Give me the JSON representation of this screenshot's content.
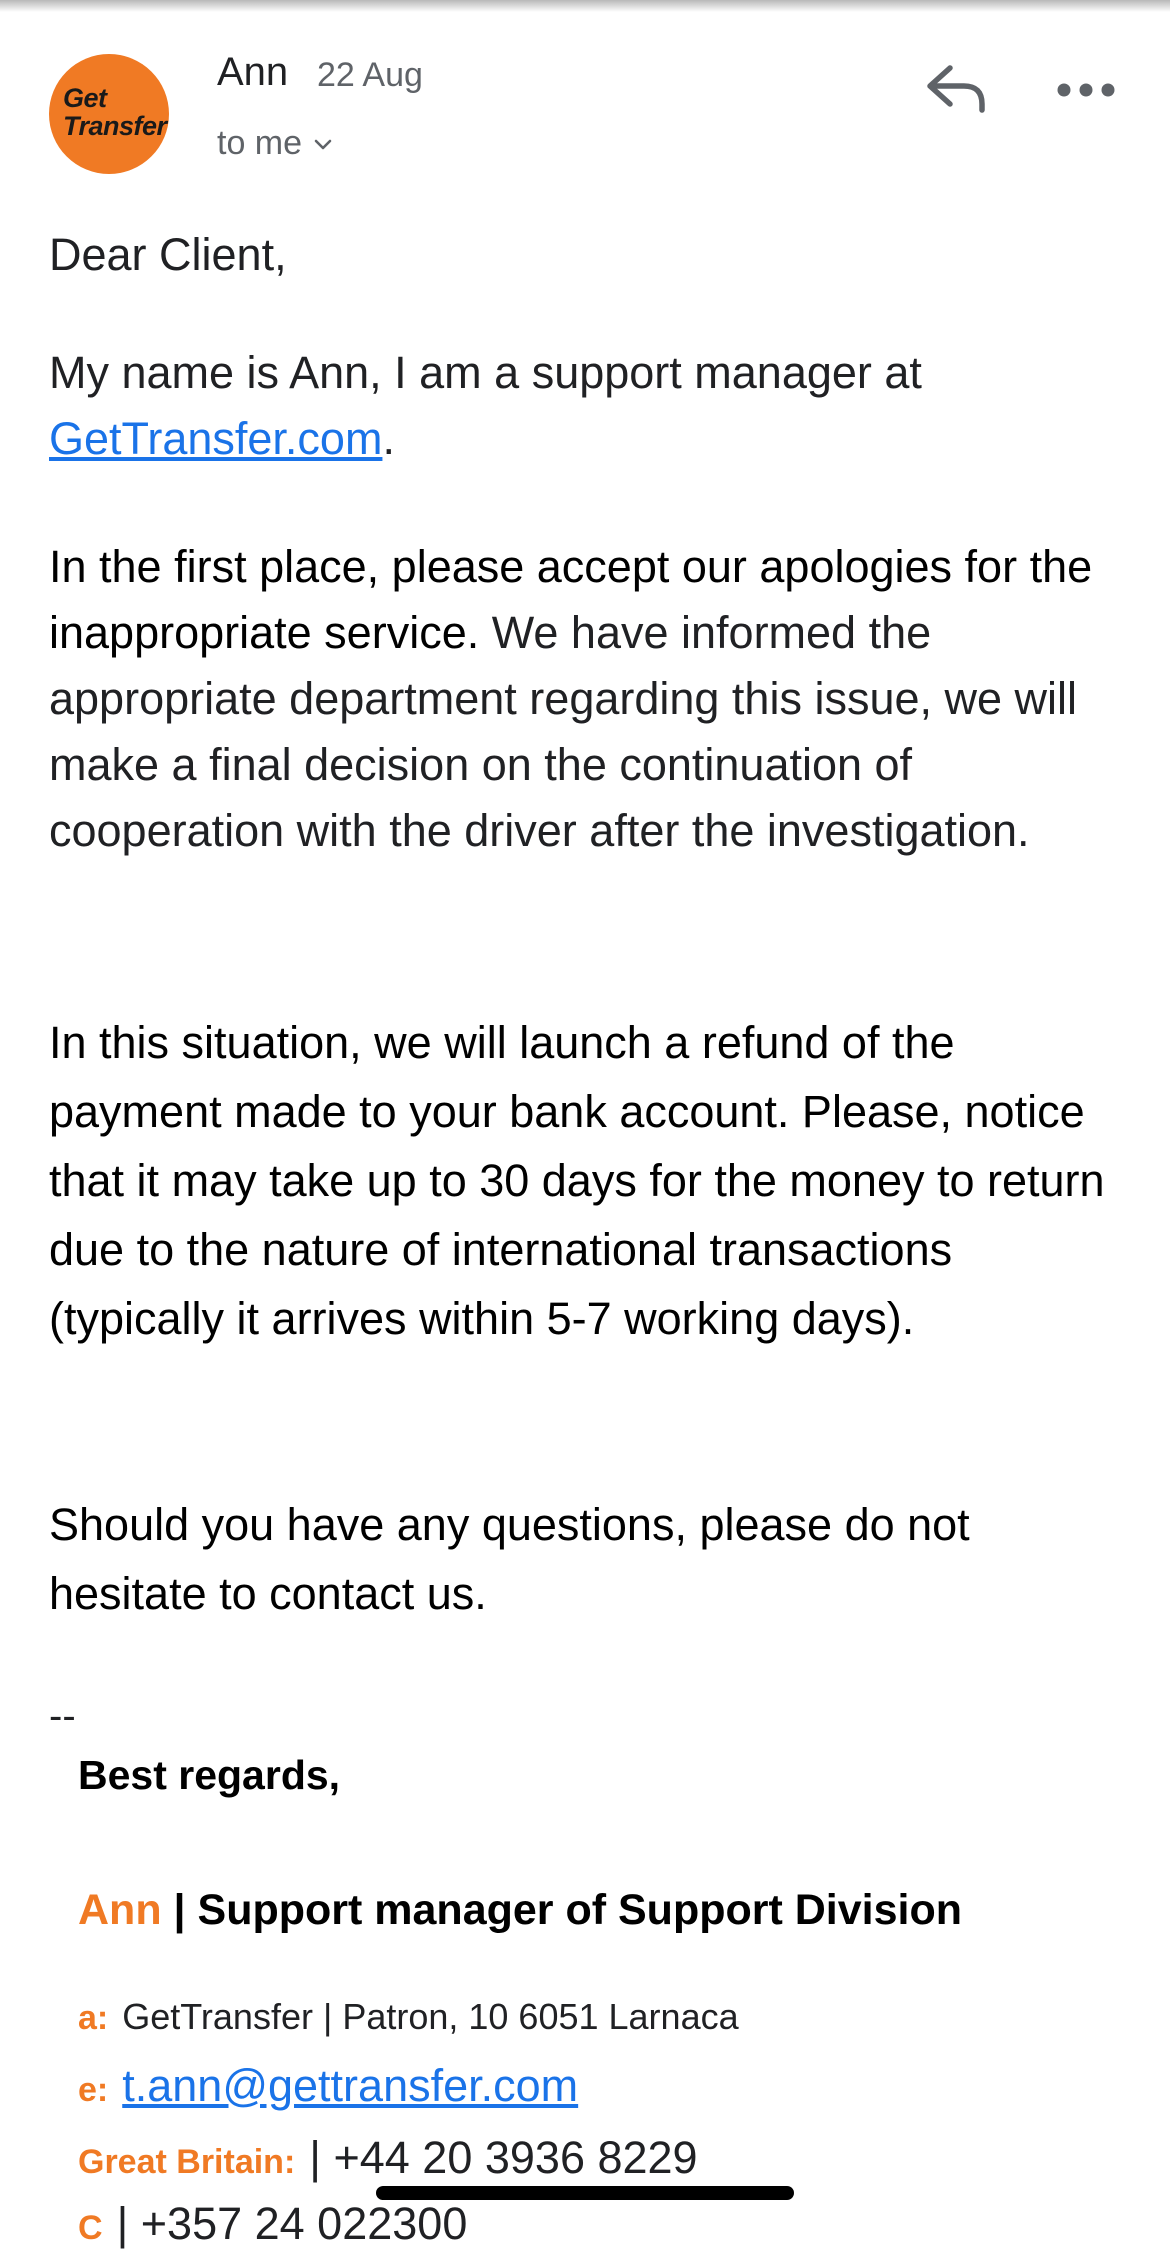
{
  "header": {
    "avatar_line1": "Get",
    "avatar_line2": "Transfer",
    "sender": "Ann",
    "date": "22 Aug",
    "recipient": "to me"
  },
  "icons": {
    "reply": "reply-icon",
    "more": "more-horizontal-icon",
    "chevron": "chevron-down-icon"
  },
  "body": {
    "greeting": "Dear Client,",
    "p1_text": "My name is Ann, I am a support manager at",
    "p1_link": "GetTransfer.com",
    "p1_end": ".",
    "p2_dark": "In the first place, please accept our apologies for the inappropriate service.",
    "p2_rest": " We have informed the appropriate department regarding this issue, we will make a final decision on the continuation of cooperation with the driver after the investigation.",
    "p3": "In this situation, we will launch a refund of the payment made to your bank account. Please, notice that it may take up to 30 days for the money to return due to the nature of international transactions (typically it arrives within 5-7 working days).",
    "p4": "Should you have any questions, please do not hesitate to contact us."
  },
  "signature": {
    "dash": "--",
    "regards": "Best regards,",
    "name": "Ann",
    "sep": " | ",
    "title": "Support manager of Support Division",
    "address_label": "a:",
    "address": "GetTransfer | Patron, 10 6051 Larnaca",
    "email_label": "e:",
    "email": "t.ann@gettransfer.com",
    "gb_label": "Great Britain:",
    "gb_sep": "| ",
    "gb_phone": "+44 20 3936 8229",
    "next_label": "C",
    "next_sep": "| ",
    "next_phone": "+357 24 022300"
  },
  "colors": {
    "brand_orange": "#f07a24",
    "link_blue": "#1a73e8"
  }
}
